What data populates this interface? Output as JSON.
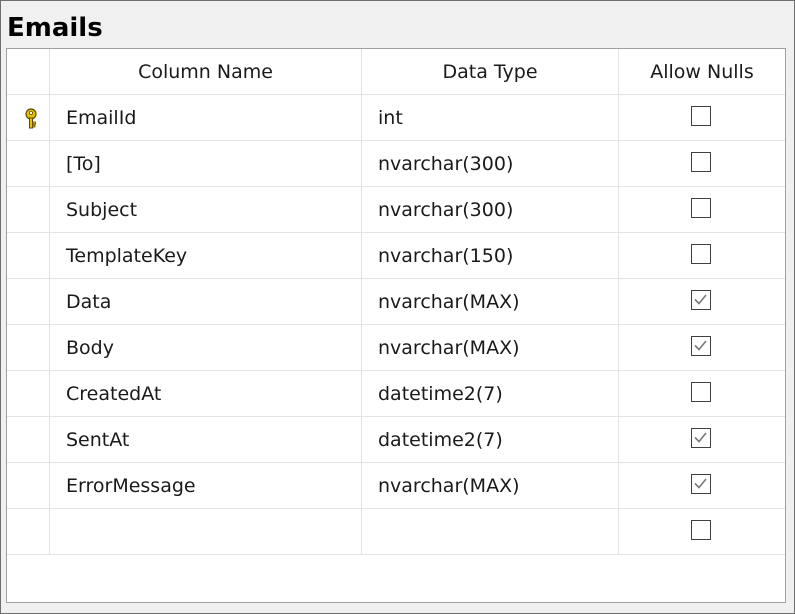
{
  "table": {
    "name": "Emails",
    "headers": {
      "column_name": "Column Name",
      "data_type": "Data Type",
      "allow_nulls": "Allow Nulls"
    },
    "rows": [
      {
        "column_name": "EmailId",
        "data_type": "int",
        "allow_nulls": false,
        "primary_key": true
      },
      {
        "column_name": "[To]",
        "data_type": "nvarchar(300)",
        "allow_nulls": false
      },
      {
        "column_name": "Subject",
        "data_type": "nvarchar(300)",
        "allow_nulls": false
      },
      {
        "column_name": "TemplateKey",
        "data_type": "nvarchar(150)",
        "allow_nulls": false
      },
      {
        "column_name": "Data",
        "data_type": "nvarchar(MAX)",
        "allow_nulls": true
      },
      {
        "column_name": "Body",
        "data_type": "nvarchar(MAX)",
        "allow_nulls": true
      },
      {
        "column_name": "CreatedAt",
        "data_type": "datetime2(7)",
        "allow_nulls": false
      },
      {
        "column_name": "SentAt",
        "data_type": "datetime2(7)",
        "allow_nulls": true
      },
      {
        "column_name": "ErrorMessage",
        "data_type": "nvarchar(MAX)",
        "allow_nulls": true
      },
      {
        "column_name": "",
        "data_type": "",
        "allow_nulls": false
      }
    ]
  },
  "icons": {
    "primary_key": "key-icon",
    "checked": "checkmark-icon"
  },
  "colors": {
    "key_gold": "#e8c400",
    "check_gray": "#7a7a7a"
  }
}
